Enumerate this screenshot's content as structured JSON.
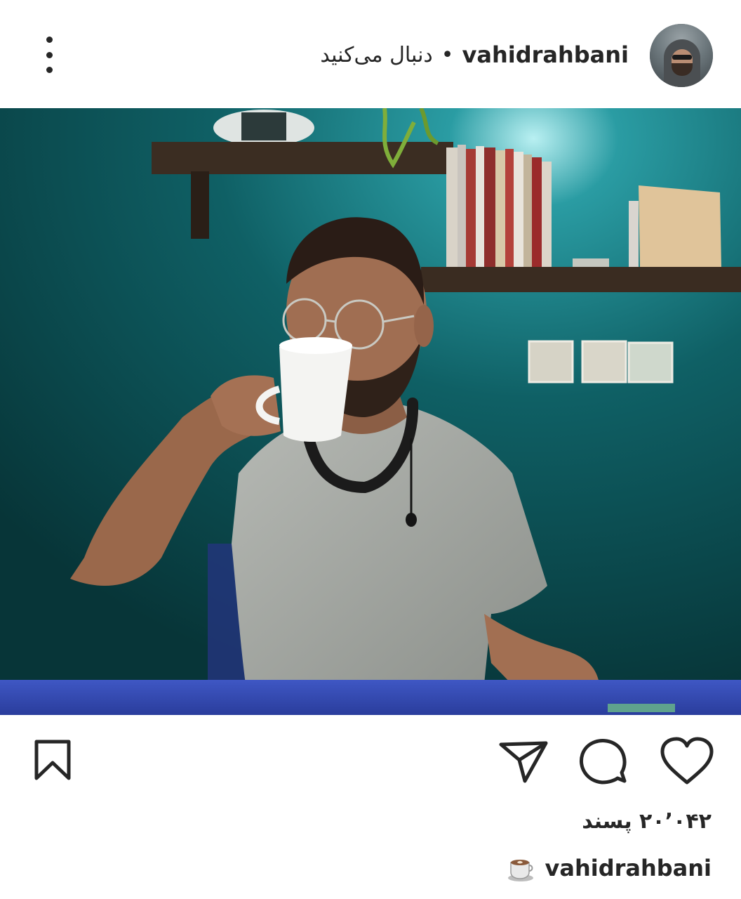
{
  "header": {
    "username": "vahidrahbani",
    "separator": "•",
    "follow_status": "دنبال می‌کنید",
    "more_icon": "more-vertical-icon"
  },
  "post": {
    "image_alt": "Man in grey t-shirt and glasses drinking from a white mug in front of a teal wall with a bookshelf"
  },
  "actions": {
    "like_icon": "heart-icon",
    "comment_icon": "comment-icon",
    "share_icon": "send-icon",
    "save_icon": "bookmark-icon"
  },
  "stats": {
    "likes_text": "۲۰٬۰۴۲ پسند"
  },
  "caption": {
    "username": "vahidrahbani",
    "emoji_icon": "coffee-cup-icon"
  },
  "colors": {
    "text": "#262626",
    "wall": "#0e4a4f",
    "background": "#ffffff"
  }
}
